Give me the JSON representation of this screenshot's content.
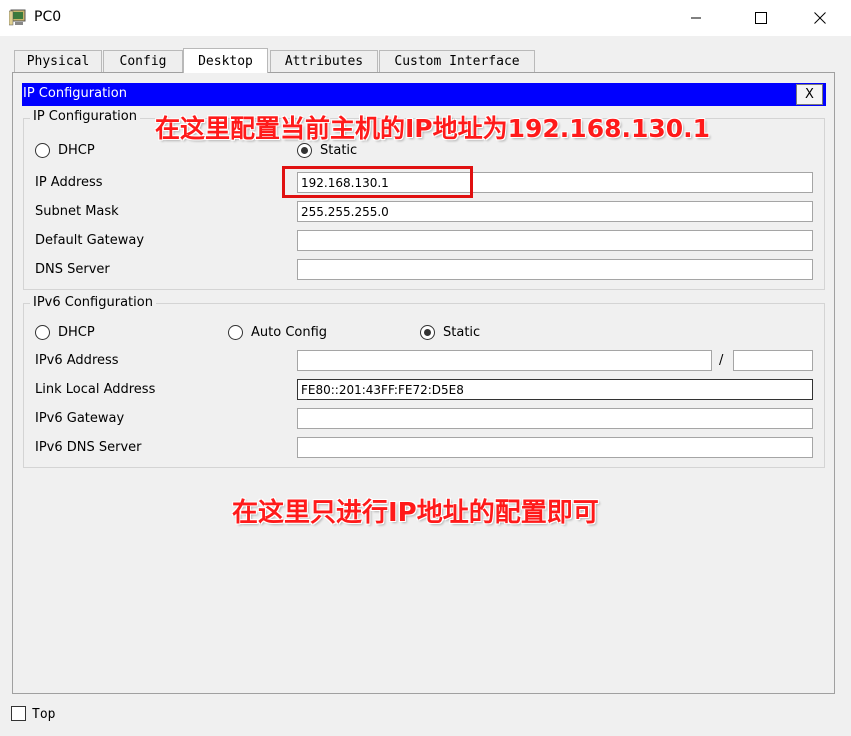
{
  "window": {
    "title": "PC0",
    "icon": "pc-icon"
  },
  "tabs": [
    "Physical",
    "Config",
    "Desktop",
    "Attributes",
    "Custom Interface"
  ],
  "active_tab": "Desktop",
  "ip_config": {
    "header": "IP Configuration",
    "close_label": "X",
    "ipv4": {
      "group_label": "IP Configuration",
      "dhcp_label": "DHCP",
      "static_label": "Static",
      "selected": "Static",
      "ip_address_label": "IP Address",
      "ip_address": "192.168.130.1",
      "subnet_mask_label": "Subnet Mask",
      "subnet_mask": "255.255.255.0",
      "default_gateway_label": "Default Gateway",
      "default_gateway": "",
      "dns_server_label": "DNS Server",
      "dns_server": ""
    },
    "ipv6": {
      "group_label": "IPv6 Configuration",
      "dhcp_label": "DHCP",
      "auto_config_label": "Auto Config",
      "static_label": "Static",
      "selected": "Static",
      "address_label": "IPv6 Address",
      "address": "",
      "slash": "/",
      "prefix": "",
      "link_local_label": "Link Local Address",
      "link_local": "FE80::201:43FF:FE72:D5E8",
      "gateway_label": "IPv6 Gateway",
      "gateway": "",
      "dns_label": "IPv6 DNS Server",
      "dns": ""
    }
  },
  "annotations": {
    "top": "在这里配置当前主机的IP地址为192.168.130.1",
    "bottom": "在这里只进行IP地址的配置即可",
    "color": "#ff1a1a"
  },
  "footer": {
    "top_label": "Top",
    "top_checked": false
  },
  "colors": {
    "header_blue": "#0000ff",
    "highlight_red": "#e01010"
  }
}
